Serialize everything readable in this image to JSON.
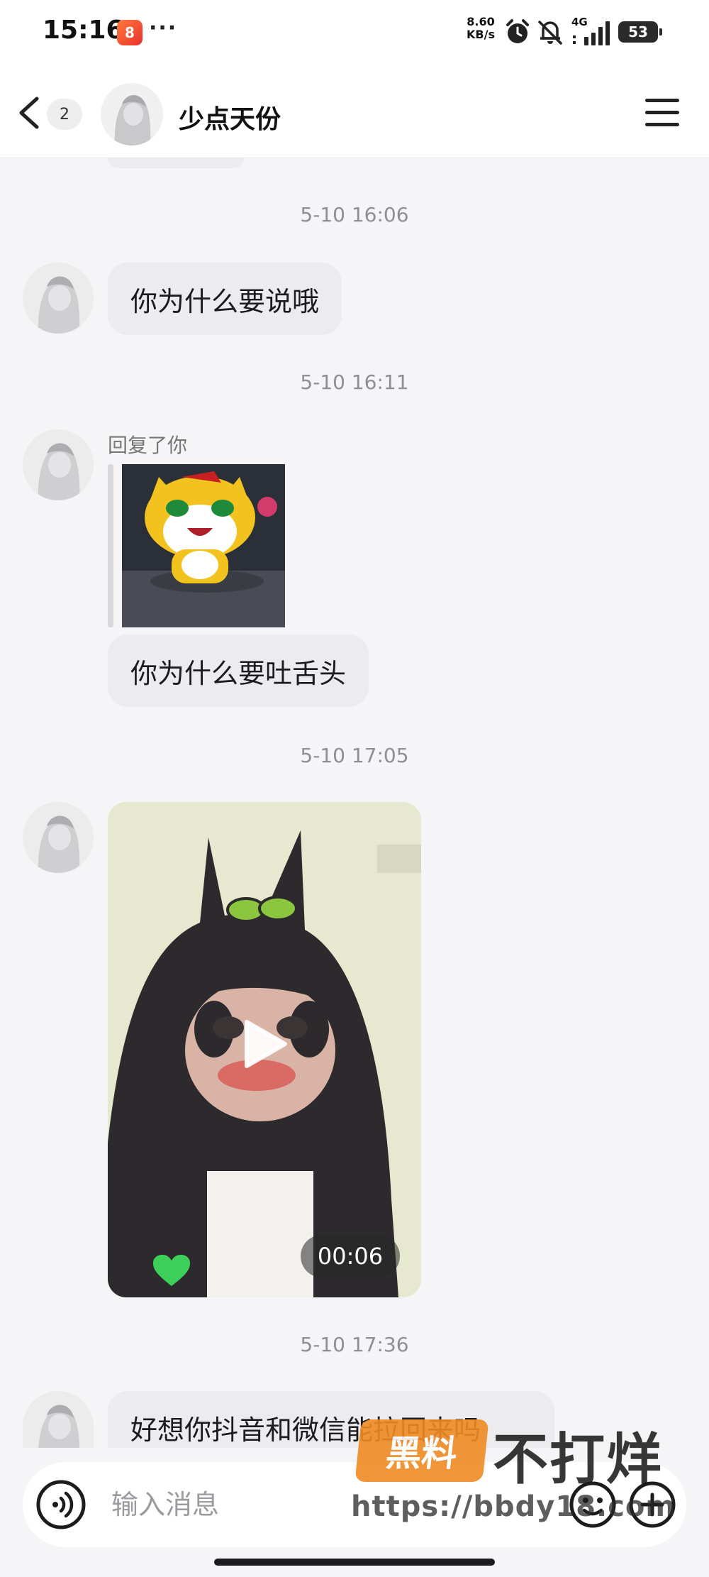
{
  "status_bar": {
    "time": "15:16",
    "app_badge": "8",
    "more": "···",
    "net_speed": "8.60",
    "net_unit": "KB/s",
    "network": "4G",
    "battery": "53"
  },
  "header": {
    "unread_count": "2",
    "contact_name": "少点天份"
  },
  "messages": [
    {
      "timestamp": "5-10 16:06",
      "text": "你为什么要说哦"
    },
    {
      "timestamp": "5-10 16:11",
      "reply_label": "回复了你",
      "text": "你为什么要吐舌头"
    },
    {
      "timestamp": "5-10 17:05",
      "video_duration": "00:06"
    },
    {
      "timestamp": "5-10 17:36",
      "text": "好想你抖音和微信能拉回来吗"
    }
  ],
  "input": {
    "placeholder": "输入消息"
  },
  "watermark": {
    "badge": "黑料",
    "text": "不打烊",
    "url": "https://bbdy18.com"
  },
  "icons": [
    "back-arrow-icon",
    "menu-icon",
    "voice-icon",
    "emoji-icon",
    "plus-icon",
    "play-icon",
    "heart-icon",
    "alarm-icon",
    "mute-icon",
    "signal-icon",
    "battery-icon"
  ],
  "colors": {
    "bubble": "#ececee",
    "background": "#f5f5f7",
    "timestamp": "#8e8e93",
    "heart": "#3ccf5a",
    "watermark_orange": "#f08a24"
  }
}
